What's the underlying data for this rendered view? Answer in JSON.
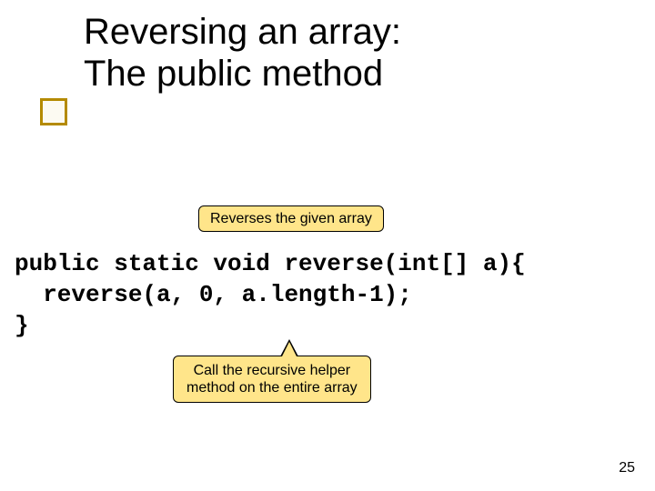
{
  "title_line1": "Reversing an array:",
  "title_line2": "The public method",
  "callout_top": "Reverses the given array",
  "code_line1": "public static void reverse(int[] a){",
  "code_line2": "  reverse(a, 0, a.length-1);",
  "code_line3": "}",
  "callout_bottom_line1": "Call the recursive helper",
  "callout_bottom_line2": "method on the entire array",
  "slide_number": "25"
}
